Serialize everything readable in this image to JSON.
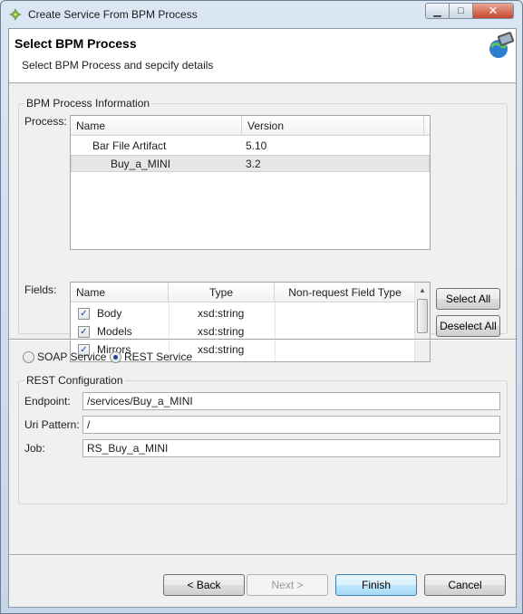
{
  "window": {
    "title": "Create Service From BPM Process"
  },
  "header": {
    "title": "Select BPM Process",
    "description": "Select BPM Process  and sepcify details"
  },
  "bpm_group": {
    "title": "BPM Process Information",
    "process_label": "Process:",
    "process_columns": [
      "Name",
      "Version"
    ],
    "processes": [
      {
        "name": "Bar File Artifact",
        "version": "5.10"
      },
      {
        "name": "Buy_a_MINI",
        "version": "3.2"
      }
    ],
    "fields_label": "Fields:",
    "field_columns": [
      "Name",
      "Type",
      "Non-request Field Type"
    ],
    "fields": [
      {
        "name": "Body",
        "type": "xsd:string",
        "nonrequest": "",
        "checked": true
      },
      {
        "name": "Models",
        "type": "xsd:string",
        "nonrequest": "",
        "checked": true
      },
      {
        "name": "Mirrors",
        "type": "xsd:string",
        "nonrequest": "",
        "checked": true
      }
    ],
    "select_all": "Select All",
    "deselect_all": "Deselect All"
  },
  "service_type": {
    "soap_label": "SOAP Service",
    "rest_label": "REST Service",
    "selected": "REST Service"
  },
  "rest_group": {
    "title": "REST Configuration",
    "endpoint_label": "Endpoint:",
    "endpoint_value": "/services/Buy_a_MINI",
    "uri_label": "Uri Pattern:",
    "uri_value": "/",
    "job_label": "Job:",
    "job_value": "RS_Buy_a_MINI"
  },
  "footer": {
    "back": "< Back",
    "next": "Next >",
    "finish": "Finish",
    "cancel": "Cancel"
  },
  "colors": {
    "accent": "#1c3f94",
    "default_button": "#3c7fb1"
  }
}
